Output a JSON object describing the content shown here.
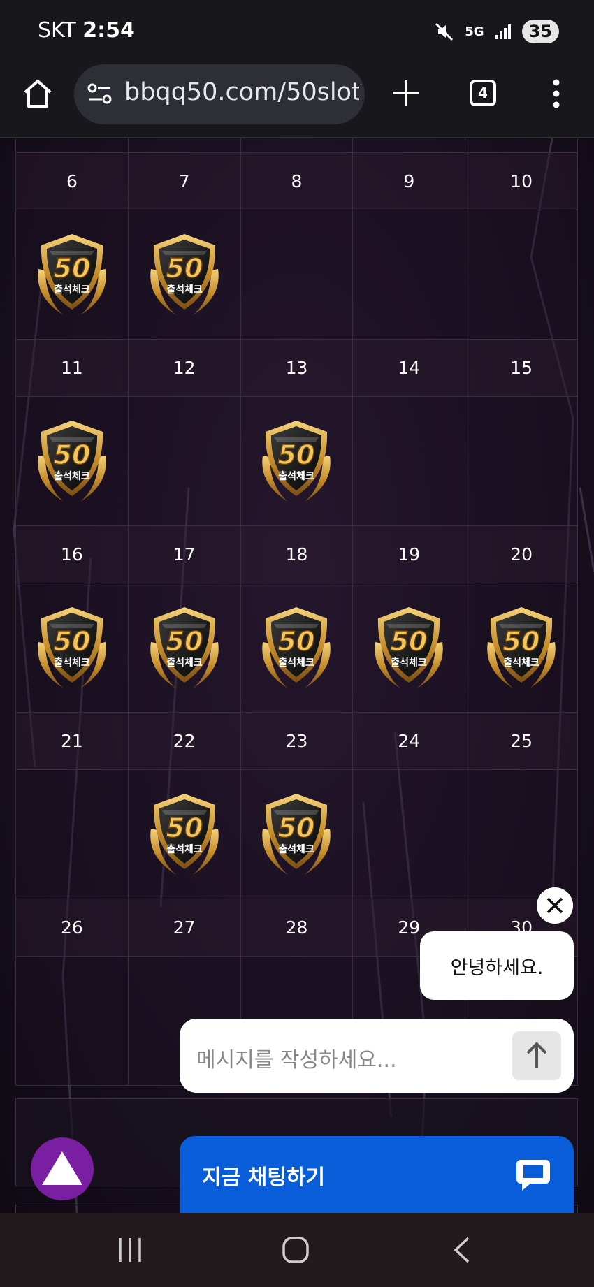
{
  "status_bar": {
    "carrier": "SKT",
    "time": "2:54",
    "network": "5G",
    "battery": "35"
  },
  "browser": {
    "url": "bbqq50.com/50slot_",
    "tab_count": "4"
  },
  "calendar": {
    "badge_text_top": "50",
    "badge_text_bottom": "출석체크",
    "weeks": [
      {
        "days": [
          "6",
          "7",
          "8",
          "9",
          "10"
        ],
        "checked": [
          true,
          true,
          false,
          false,
          false
        ]
      },
      {
        "days": [
          "11",
          "12",
          "13",
          "14",
          "15"
        ],
        "checked": [
          true,
          false,
          true,
          false,
          false
        ]
      },
      {
        "days": [
          "16",
          "17",
          "18",
          "19",
          "20"
        ],
        "checked": [
          true,
          true,
          true,
          true,
          true
        ]
      },
      {
        "days": [
          "21",
          "22",
          "23",
          "24",
          "25"
        ],
        "checked": [
          false,
          true,
          true,
          false,
          false
        ]
      },
      {
        "days": [
          "26",
          "27",
          "28",
          "29",
          "30"
        ],
        "checked": [
          false,
          false,
          false,
          false,
          false
        ]
      }
    ]
  },
  "chat": {
    "greeting": "안녕하세요.",
    "input_placeholder": "메시지를 작성하세요...",
    "chat_now_label": "지금 채팅하기"
  },
  "colors": {
    "chat_blue": "#0a5dd8",
    "scroll_button": "#7b1fa2",
    "badge_gold": "#d9a441"
  },
  "icons": [
    "home-icon",
    "site-settings-icon",
    "plus-icon",
    "tabs-icon",
    "more-icon",
    "close-icon",
    "arrow-up-icon",
    "triangle-up-icon",
    "chat-bubble-icon",
    "recent-apps-icon",
    "home-nav-icon",
    "back-icon",
    "mute-icon",
    "signal-icon"
  ]
}
